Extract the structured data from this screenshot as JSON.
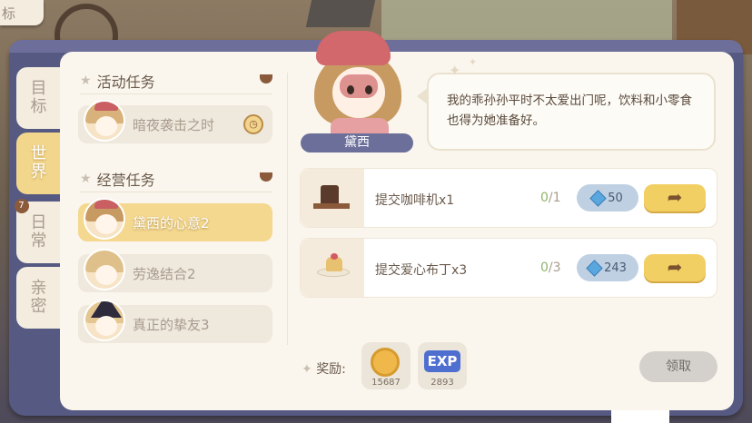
{
  "top_tab": "标",
  "side_tabs": [
    {
      "label": "目标",
      "active": false
    },
    {
      "label": "世界",
      "active": true
    },
    {
      "label": "日常",
      "active": false,
      "badge": "7"
    },
    {
      "label": "亲密",
      "active": false
    }
  ],
  "activity_section": {
    "title": "活动任务",
    "tasks": [
      {
        "label": "暗夜袭击之时",
        "icon": "clock-icon"
      }
    ]
  },
  "business_section": {
    "title": "经营任务",
    "tasks": [
      {
        "label": "黛西的心意2",
        "active": true
      },
      {
        "label": "劳逸结合2",
        "active": false
      },
      {
        "label": "真正的挚友3",
        "active": false
      }
    ]
  },
  "character": {
    "name": "黛西",
    "dialogue": "我的乖孙孙平时不太爱出门呢，饮料和小零食也得为她准备好。"
  },
  "quests": [
    {
      "text": "提交咖啡机x1",
      "progress": "0",
      "total": "/1",
      "gems": "50",
      "icon": "coffee-machine-icon"
    },
    {
      "text": "提交爱心布丁x3",
      "progress": "0",
      "total": "/3",
      "gems": "243",
      "icon": "pudding-icon"
    }
  ],
  "reward": {
    "label": "奖励:",
    "coin_amount": "15687",
    "exp_label": "EXP",
    "exp_amount": "2893"
  },
  "claim_button": "领取",
  "colors": {
    "frame": "#565a82",
    "panel": "#faf6ee",
    "active_tab": "#f2d68b",
    "go_button": "#f2cf63",
    "claim_button": "#d4d1cc"
  }
}
